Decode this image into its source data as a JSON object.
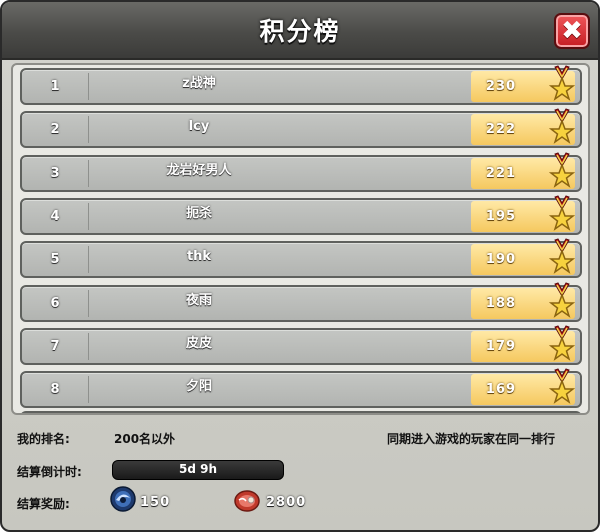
{
  "header": {
    "title": "积分榜"
  },
  "close_button": {
    "icon": "close-icon",
    "symbol": "✖",
    "color": "#d92b30"
  },
  "leaderboard": {
    "rows": [
      {
        "rank": "1",
        "name": "z战神",
        "score": "230"
      },
      {
        "rank": "2",
        "name": "lcy",
        "score": "222"
      },
      {
        "rank": "3",
        "name": "龙岩好男人",
        "score": "221"
      },
      {
        "rank": "4",
        "name": "扼杀",
        "score": "195"
      },
      {
        "rank": "5",
        "name": "thk",
        "score": "190"
      },
      {
        "rank": "6",
        "name": "夜雨",
        "score": "188"
      },
      {
        "rank": "7",
        "name": "皮皮",
        "score": "179"
      },
      {
        "rank": "8",
        "name": "夕阳",
        "score": "169"
      }
    ],
    "medal_icon": "star-medal-icon"
  },
  "footer": {
    "my_rank_label": "我的排名:",
    "my_rank_value": "200名以外",
    "rule_note": "同期进入游戏的玩家在同一排行",
    "countdown_label": "结算倒计时:",
    "countdown_value": "5d 9h",
    "reward_label": "结算奖励:",
    "rewards": [
      {
        "icon": "gem-orb-icon",
        "value": "150"
      },
      {
        "icon": "meat-icon",
        "value": "2800"
      }
    ]
  },
  "colors": {
    "score_bg": "#f5c85f",
    "row_bg": "#b9bbb8",
    "title_bar": "#4b4b48"
  }
}
